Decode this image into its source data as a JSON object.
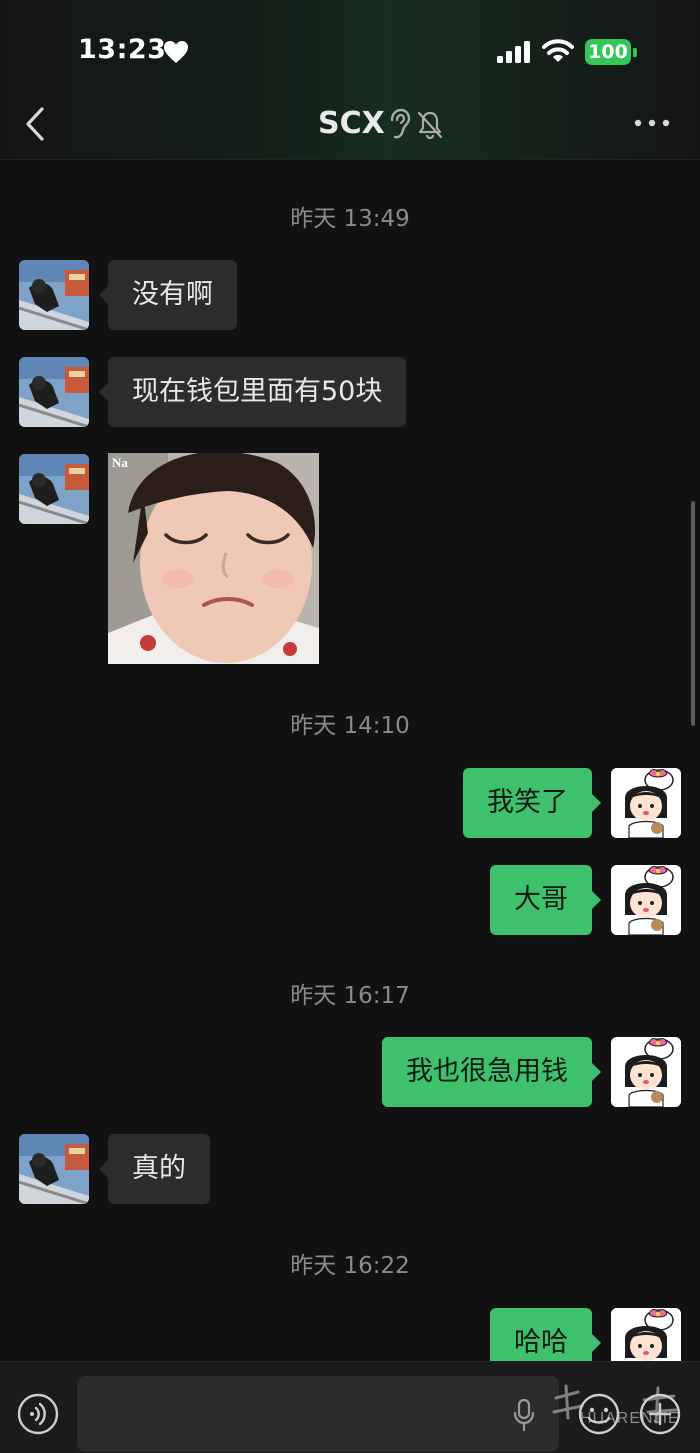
{
  "status_bar": {
    "time": "13:23",
    "battery": "100",
    "icons": [
      "heart-icon",
      "signal-icon",
      "wifi-icon",
      "battery-icon"
    ]
  },
  "nav": {
    "title": "SCX",
    "icons": [
      "back-icon",
      "ear-icon",
      "mute-bell-icon",
      "more-icon"
    ]
  },
  "messages": [
    {
      "kind": "timestamp",
      "text": "昨天 13:49"
    },
    {
      "kind": "text",
      "from": "them",
      "text": "没有啊"
    },
    {
      "kind": "text",
      "from": "them",
      "text": "现在钱包里面有50块"
    },
    {
      "kind": "image",
      "from": "them",
      "overlay_text": "Na"
    },
    {
      "kind": "timestamp",
      "text": "昨天 14:10"
    },
    {
      "kind": "text",
      "from": "me",
      "text": "我笑了"
    },
    {
      "kind": "text",
      "from": "me",
      "text": "大哥"
    },
    {
      "kind": "timestamp",
      "text": "昨天 16:17"
    },
    {
      "kind": "text",
      "from": "me",
      "text": "我也很急用钱"
    },
    {
      "kind": "text",
      "from": "them",
      "text": "真的"
    },
    {
      "kind": "timestamp",
      "text": "昨天 16:22"
    },
    {
      "kind": "text",
      "from": "me",
      "text": "哈哈"
    }
  ],
  "input_bar": {
    "value": "",
    "icons": [
      "voice-icon",
      "mic-icon",
      "emoji-icon",
      "plus-icon"
    ]
  },
  "watermark": {
    "text": "HUARENJIE"
  },
  "colors": {
    "background": "#111111",
    "incoming_bubble": "#2c2c2c",
    "outgoing_bubble": "#3fc06d",
    "battery": "#33c659"
  }
}
